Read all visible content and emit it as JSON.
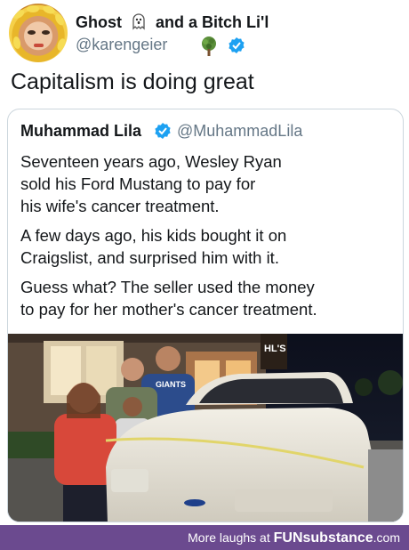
{
  "tweet": {
    "display_name": "Ghost",
    "display_name_suffix": "and a Bitch Li'l",
    "handle": "@karengeier",
    "text": "Capitalism is doing great"
  },
  "quoted_tweet": {
    "display_name": "Muhammad Lila",
    "handle": "@MuhammadLila",
    "paragraphs": [
      "Seventeen years ago, Wesley Ryan\nsold his Ford Mustang to pay for\nhis wife's cancer treatment.",
      "A few days ago, his kids bought it on\nCraigslist, and surprised him with it.",
      "Guess what? The seller used the money\nto pay for her mother's cancer treatment."
    ],
    "photo": {
      "store_sign": "HL'S",
      "shirt_text": "GIANTS"
    }
  },
  "footer": {
    "prefix": "More laughs at",
    "brand": "FUNsubstance",
    "suffix": ".com"
  },
  "colors": {
    "footer_bg": "#6b4a8f",
    "verified": "#1da1f2",
    "handle": "#657786"
  },
  "icons": [
    "ghost-icon",
    "tree-icon",
    "verified-badge-icon"
  ]
}
